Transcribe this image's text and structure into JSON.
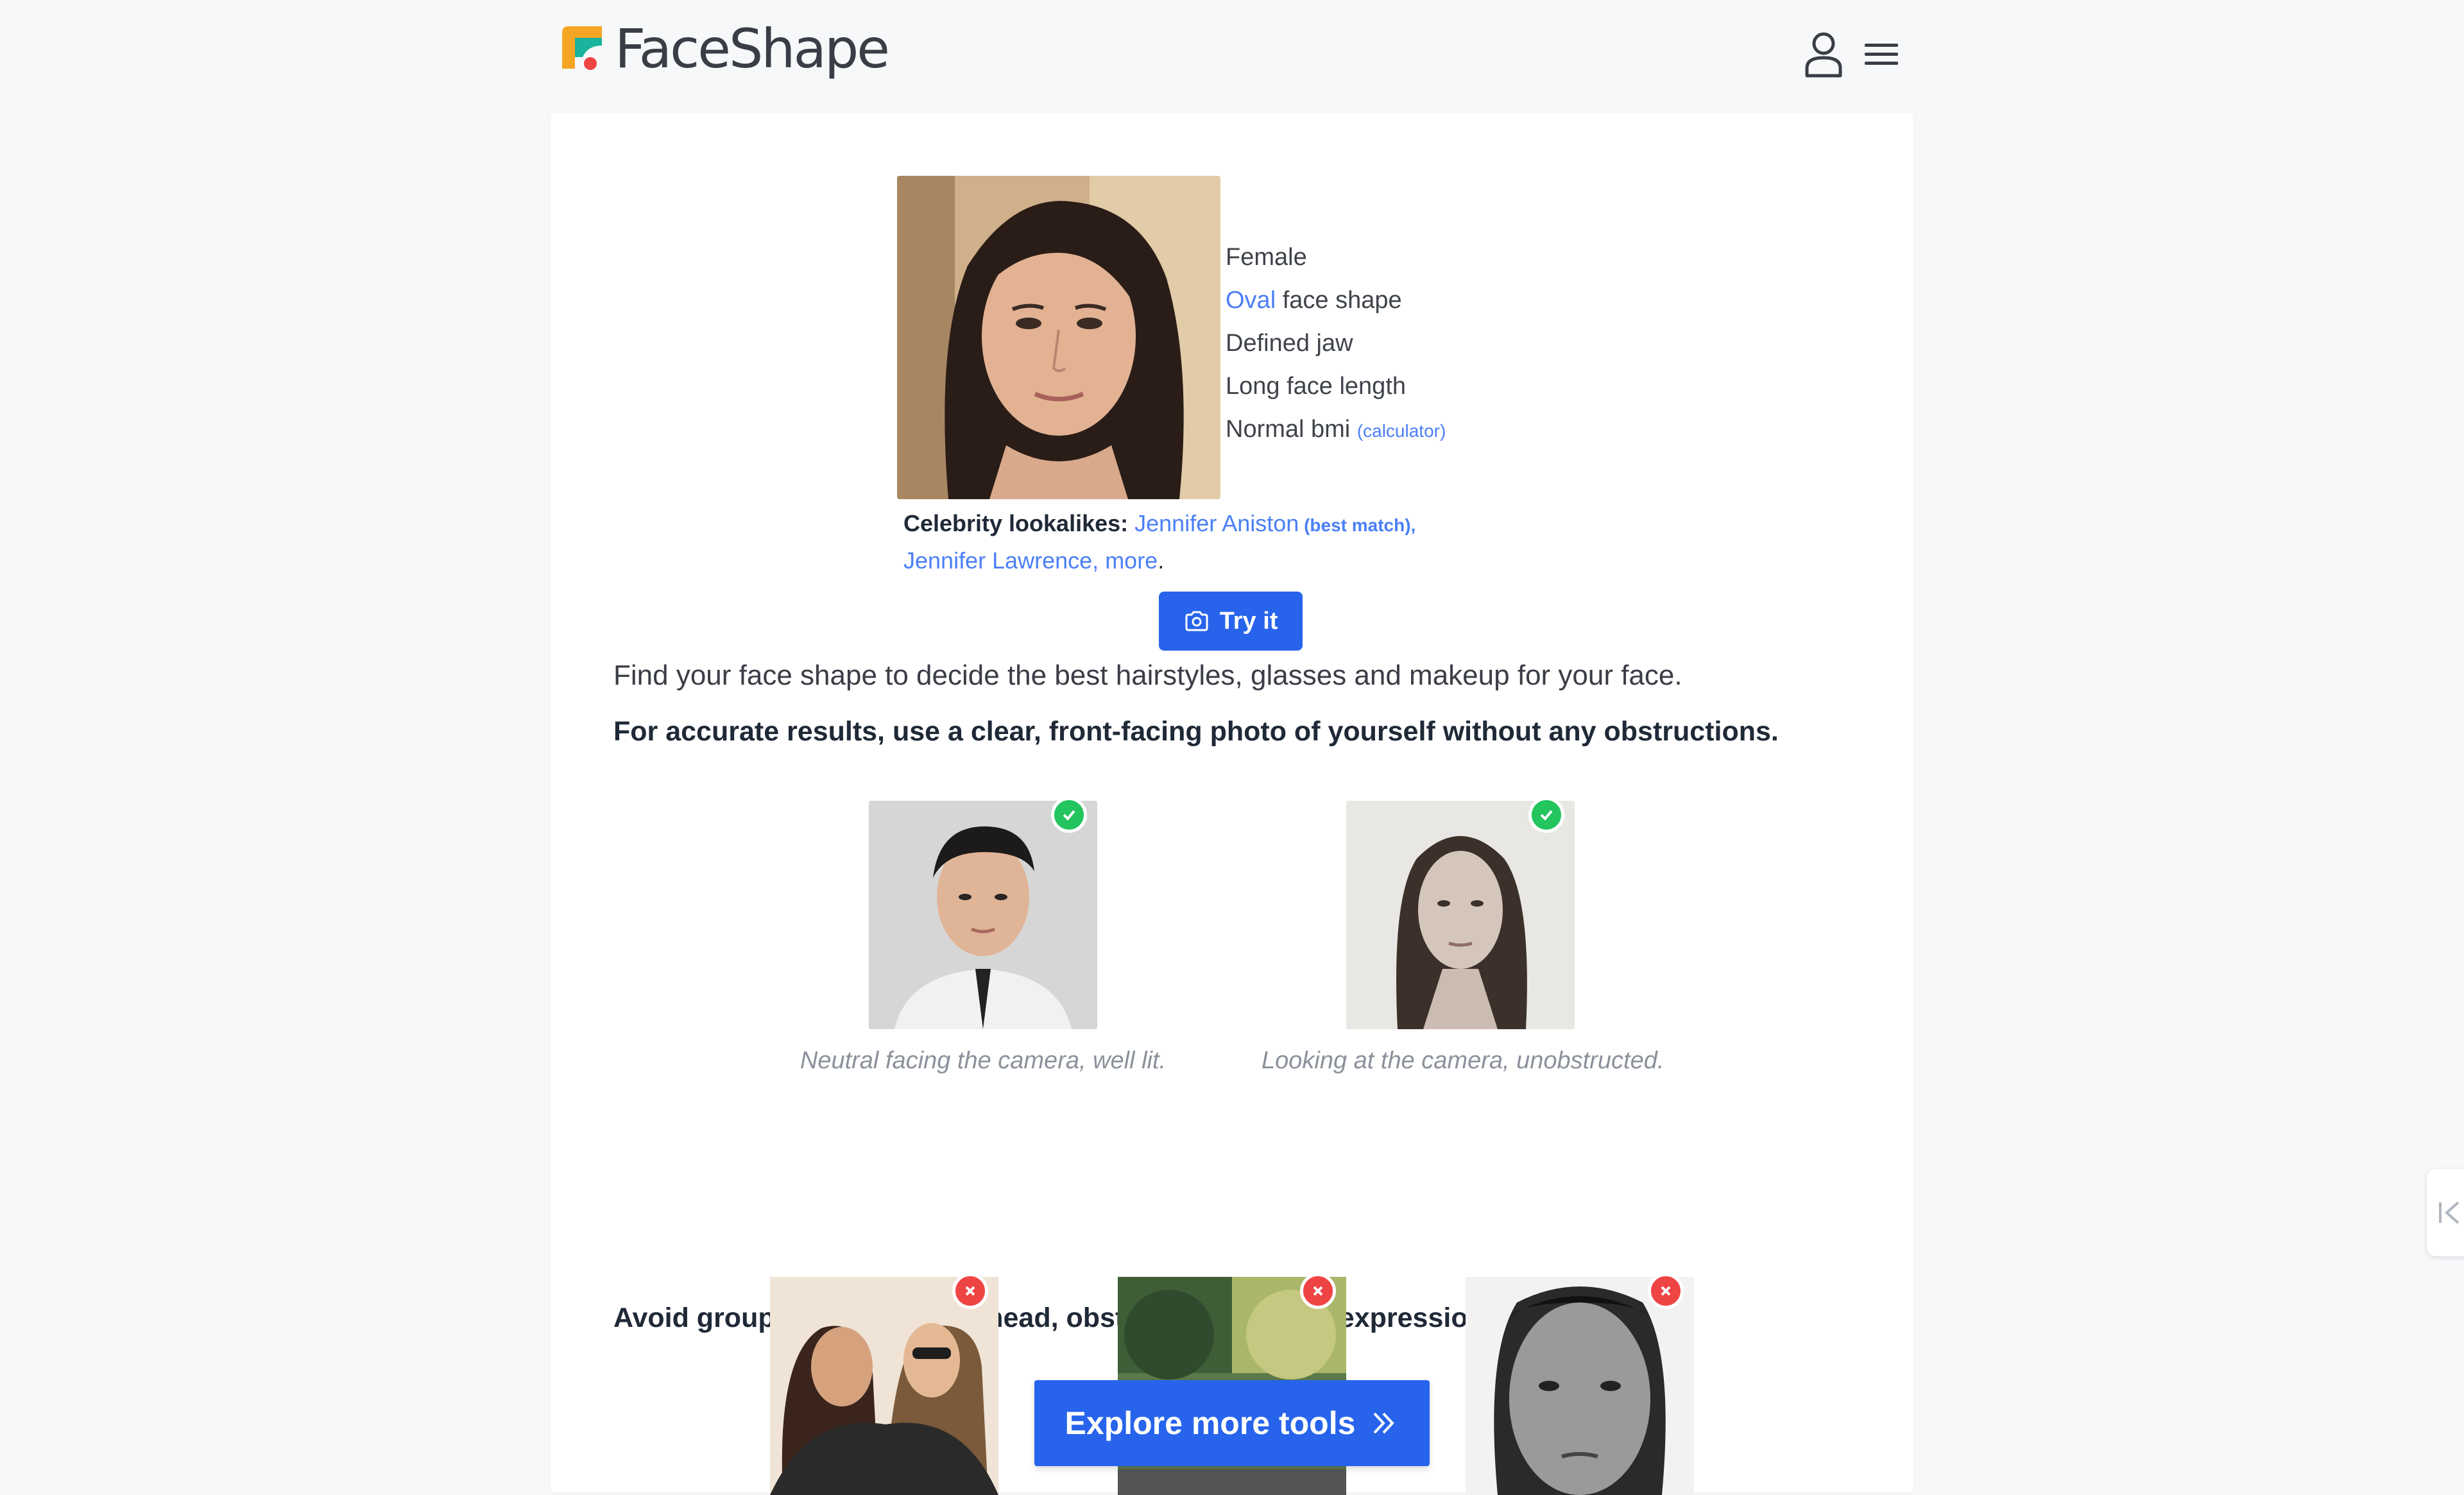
{
  "brand": {
    "name": "FaceShape"
  },
  "example": {
    "traits": {
      "gender": "Female",
      "face_shape_value": "Oval",
      "face_shape_suffix": " face shape",
      "jaw": "Defined jaw",
      "length": "Long face length",
      "bmi": "Normal bmi ",
      "bmi_link": "(calculator)"
    },
    "celebrity": {
      "label": "Celebrity lookalikes: ",
      "first": "Jennifer Aniston",
      "best_match": " (best match),",
      "second": "Jennifer Lawrence",
      "sep": ", ",
      "more": "more",
      "end": "."
    }
  },
  "try_button": "Try it",
  "intro": "Find your face shape to decide the best hairstyles, glasses and makeup for your face.",
  "accurate": "For accurate results, use a clear, front-facing photo of yourself without any obstructions.",
  "good_examples": [
    {
      "caption": "Neutral facing the camera, well lit."
    },
    {
      "caption": "Looking at the camera, unobstructed."
    }
  ],
  "avoid": "Avoid group photos, angled head, obstructions or face expressions.",
  "explore_button": "Explore more tools",
  "colors": {
    "accent": "#2764eb",
    "link": "#4b7ff5",
    "ok": "#22c55e",
    "bad": "#ef4444"
  },
  "icons": [
    "user-icon",
    "menu-icon",
    "camera-icon",
    "double-chevron-right-icon",
    "check-icon",
    "x-icon",
    "collapse-icon"
  ]
}
